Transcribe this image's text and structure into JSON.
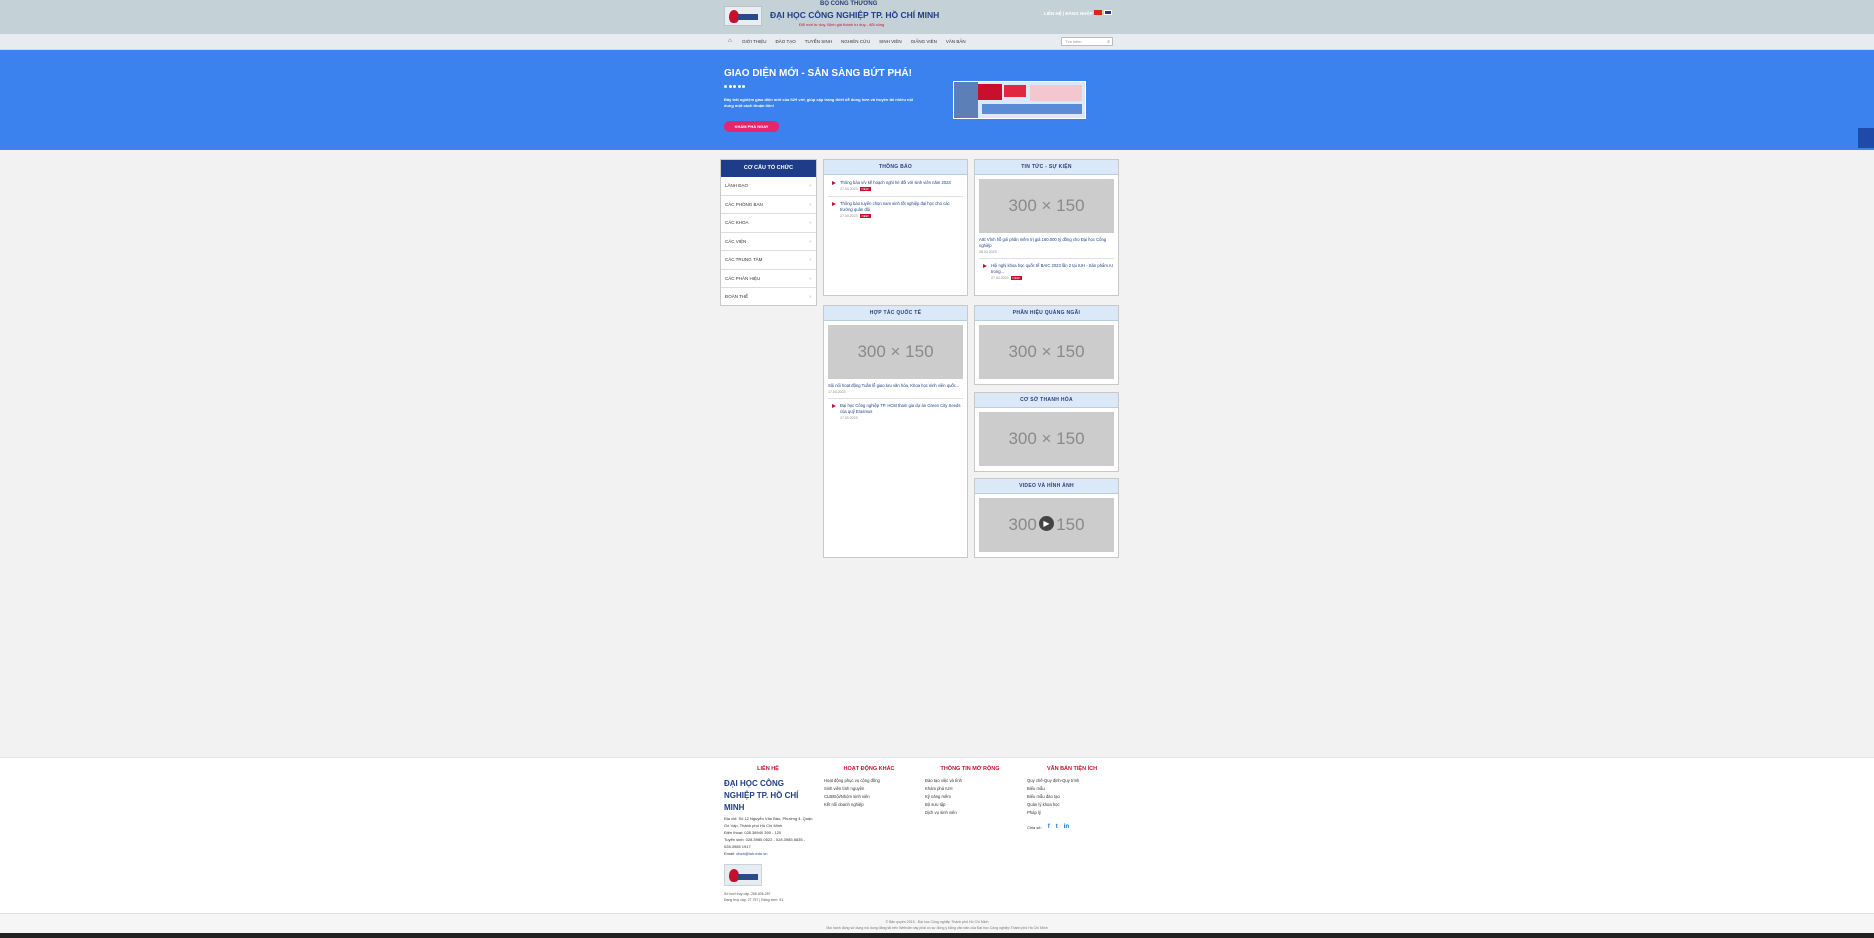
{
  "header": {
    "ministry": "BỘ CÔNG THƯƠNG",
    "university": "ĐẠI HỌC CÔNG NGHIỆP TP. HỒ CHÍ MINH",
    "slogan": "Đổi mới tư duy, Định giá thành tư duy - đổi công",
    "lang_links": "LIÊN HỆ | ĐĂNG NHẬP"
  },
  "nav": {
    "home_icon": "home-icon",
    "items": [
      "GIỚI THIỆU",
      "ĐÀO TẠO",
      "TUYỂN SINH",
      "NGHIÊN CỨU",
      "SINH VIÊN",
      "GIẢNG VIÊN",
      "VĂN BẢN"
    ],
    "search_placeholder": "Tìm kiếm"
  },
  "hero": {
    "title": "GIAO DIỆN MỚI - SẴN SÀNG BỨT PHÁ!",
    "description": "Đây trải nghiệm giao diện mới của IUH với, giúp cập trang thiết dễ dùng hơn và truyền tải nhiều nội dung một cách thuận tiện!",
    "button": "KHÁM PHÁ NGAY",
    "bg_color": "#3b82ee",
    "button_color": "#e6256f"
  },
  "org": {
    "title": "CƠ CẤU TỔ CHỨC",
    "items": [
      "LÃNH ĐẠO",
      "CÁC PHÒNG BAN",
      "CÁC KHOA",
      "CÁC VIỆN",
      "CÁC TRUNG TÂM",
      "CÁC PHÂN HIỆU",
      "ĐOÀN THỂ"
    ]
  },
  "notices": {
    "title": "THÔNG BÁO",
    "items": [
      {
        "text": "Thông báo v/v kế hoạch nghỉ hè đối với sinh viên năm 2023",
        "date": "27.04.2023",
        "badge": "NEW"
      },
      {
        "text": "Thông báo tuyển chọn nam sinh tốt nghiệp đại học cho các trường quân đội",
        "date": "27.04.2023",
        "badge": "NEW"
      }
    ]
  },
  "events": {
    "title": "TIN TỨC - SỰ KIỆN",
    "placeholder": "300 × 150",
    "caption": "AIE Vĩnh hỗ gói phần mềm trị giá 160.000 tỷ đồng cho Đại học Công nghiệp",
    "caption_date": "28.04.2023",
    "items": [
      {
        "text": "Hội nghị khoa học quốc tế BAIC 2023 lần 2 tại IUH - Sản phẩm AI trong...",
        "date": "27.04.2023",
        "badge": "NEW"
      }
    ]
  },
  "intl": {
    "title": "HỢP TÁC QUỐC TẾ",
    "placeholder": "300 × 150",
    "caption": "Sôi nổi hoạt động Tuần lễ giao lưu văn hóa, Khoa học sinh viên quốc...",
    "caption_date": "17.03.2023",
    "items": [
      {
        "text": "Đại học Công nghiệp TP. HCM tham gia dự án Green City Seeds của quỹ Erasmus",
        "date": "17.03.2023"
      }
    ]
  },
  "campus_qn": {
    "title": "PHÂN HIỆU QUẢNG NGÃI",
    "placeholder": "300 × 150"
  },
  "campus_th": {
    "title": "CƠ SỞ THANH HÓA",
    "placeholder": "300 × 150"
  },
  "media": {
    "title": "VIDEO VÀ HÌNH ẢNH",
    "placeholder": "300 × 150"
  },
  "footer": {
    "contact": {
      "title": "LIÊN HỆ",
      "name": "ĐẠI HỌC CÔNG NGHIỆP TP. HỒ CHÍ MINH",
      "address": "Địa chỉ: Số 12 Nguyễn Văn Bảo, Phường 4, Quận Gò Vấp, Thành phố Hồ Chí Minh",
      "phone": "Điện thoại: 028.38940 390 - 120",
      "admission": "Tuyển sinh: 028.3985 0522 - 028.3985 8835 - 028.3985 1917",
      "email_label": "Email:",
      "email": "dhcn@iuh.edu.vn",
      "visits": "Số lượt truy cập: 268.606.287",
      "online": "Đang truy cập: 27.757 | Đăng xem: 91"
    },
    "other": {
      "title": "HOẠT ĐỘNG KHÁC",
      "links": [
        "Hoạt động phục vụ cộng đồng",
        "Sinh viên tình nguyện",
        "CLB/Đội/Nhóm sinh viên",
        "Kết nối doanh nghiệp"
      ]
    },
    "opened": {
      "title": "THÔNG TIN MỞ RỘNG",
      "links": [
        "Đào tạo việc và tình",
        "Khám phá IUH",
        "Kỹ năng mềm",
        "Bộ sưu tập",
        "Dịch vụ sinh viên"
      ]
    },
    "docs": {
      "title": "VĂN BẢN TIỆN ÍCH",
      "links": [
        "Quy chế-Quy định-Quy trình",
        "Biểu mẫu",
        "Biểu mẫu đào tạo",
        "Quản lý khoa học",
        "Pháp lý"
      ]
    },
    "social_label": "Chia sẻ:",
    "social_icons": [
      "facebook-icon",
      "twitter-icon",
      "linkedin-icon"
    ],
    "copyright_1": "© Bản quyền 2015 - Đại học Công nghiệp Thành phố Hồ Chí Minh",
    "copyright_2": "Mọi hành động sử dụng nội dung đăng tải trên Website này phải có sự đồng ý bằng văn bản của Đại học Công nghiệp Thành phố Hồ Chí Minh"
  },
  "colors": {
    "brand": "#1f3c88",
    "accent": "#c8102e",
    "panel_head": "#dbe8f7"
  }
}
